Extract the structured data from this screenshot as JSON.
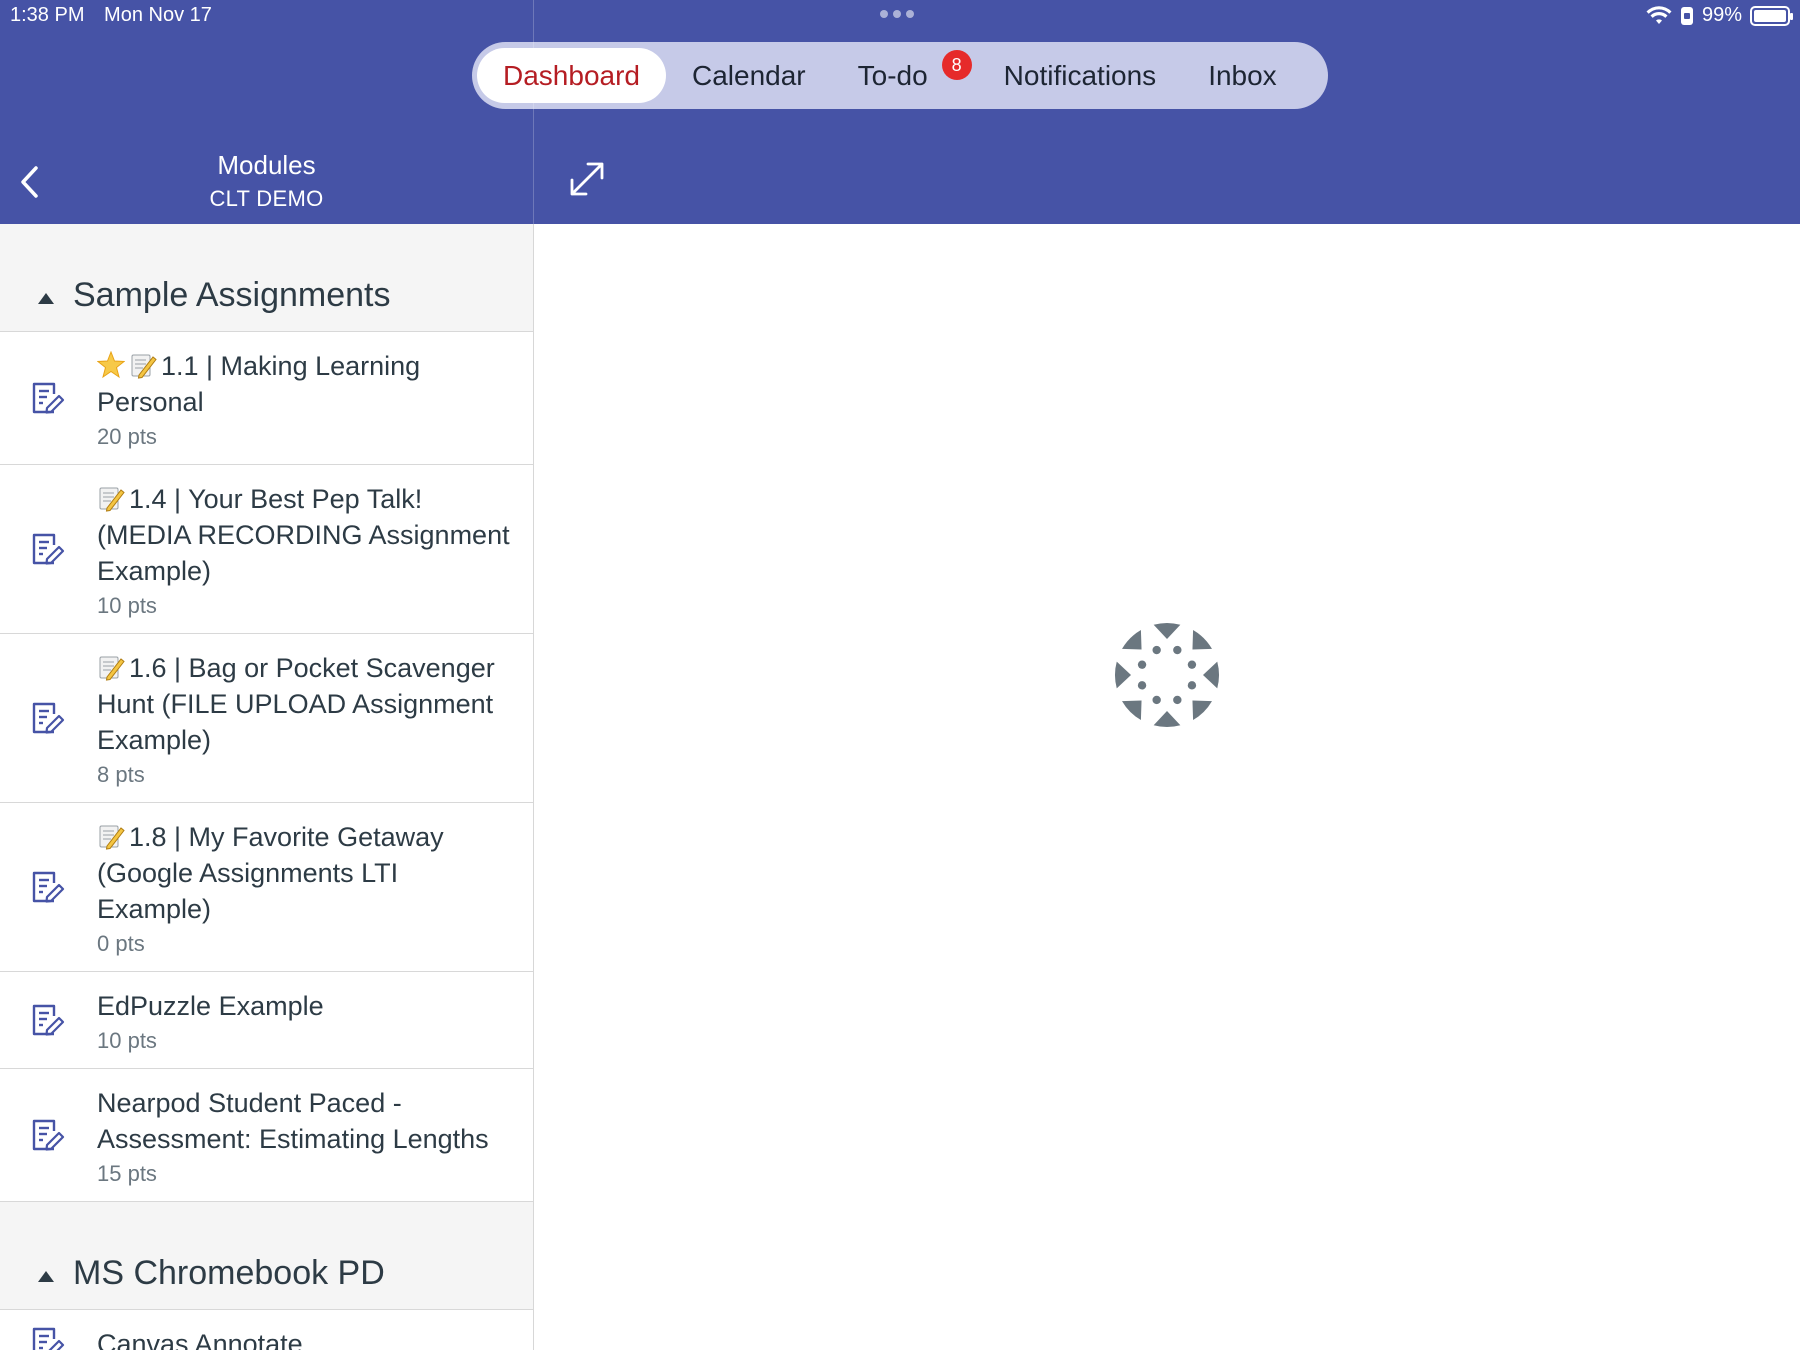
{
  "status": {
    "time": "1:38 PM",
    "date": "Mon Nov 17",
    "battery": "99%",
    "battery_level": 0.99
  },
  "tabs": [
    {
      "label": "Dashboard",
      "active": true
    },
    {
      "label": "Calendar",
      "active": false
    },
    {
      "label": "To-do",
      "active": false,
      "badge": "8"
    },
    {
      "label": "Notifications",
      "active": false
    },
    {
      "label": "Inbox",
      "active": false
    }
  ],
  "nav": {
    "title": "Modules",
    "subtitle": "CLT DEMO"
  },
  "modules": [
    {
      "title": "Sample Assignments",
      "items": [
        {
          "name": "1.1 | Making Learning Personal",
          "points": "20 pts",
          "emoji": [
            "star-emoji",
            "memo-emoji"
          ]
        },
        {
          "name": "1.4 | Your Best Pep Talk! (MEDIA RECORDING Assignment Example)",
          "points": "10 pts",
          "emoji": [
            "memo-emoji"
          ]
        },
        {
          "name": "1.6 | Bag or Pocket Scavenger Hunt (FILE UPLOAD Assignment Example)",
          "points": "8 pts",
          "emoji": [
            "memo-emoji"
          ]
        },
        {
          "name": "1.8 | My Favorite Getaway (Google Assignments LTI Example)",
          "points": "0 pts",
          "emoji": [
            "memo-emoji"
          ]
        },
        {
          "name": "EdPuzzle Example",
          "points": "10 pts",
          "emoji": []
        },
        {
          "name": "Nearpod Student Paced - Assessment: Estimating Lengths",
          "points": "15 pts",
          "emoji": []
        }
      ]
    },
    {
      "title": "MS Chromebook PD",
      "items": [
        {
          "name": "Canvas Annotate",
          "points": "",
          "emoji": []
        }
      ]
    }
  ],
  "colors": {
    "brand": "#4653a6",
    "active_tab_text": "#b51d23",
    "badge": "#e62a2a",
    "spinner": "#6b7780"
  }
}
